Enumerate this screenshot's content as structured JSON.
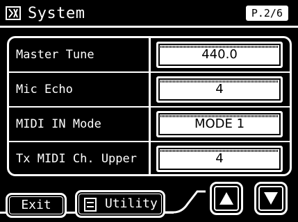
{
  "header": {
    "title": "System",
    "page_indicator": "P.2/6",
    "icon": "system-icon"
  },
  "rows": [
    {
      "label": "Master Tune",
      "value": "440.0"
    },
    {
      "label": "Mic Echo",
      "value": "4"
    },
    {
      "label": "MIDI IN Mode",
      "value": "MODE 1"
    },
    {
      "label": "Tx MIDI Ch. Upper",
      "value": "4"
    }
  ],
  "footer": {
    "exit_label": "Exit",
    "utility_label": "Utility",
    "utility_icon": "utility-icon",
    "up_icon": "arrow-up-icon",
    "down_icon": "arrow-down-icon"
  },
  "colors": {
    "background": "#000000",
    "foreground": "#ffffff"
  }
}
